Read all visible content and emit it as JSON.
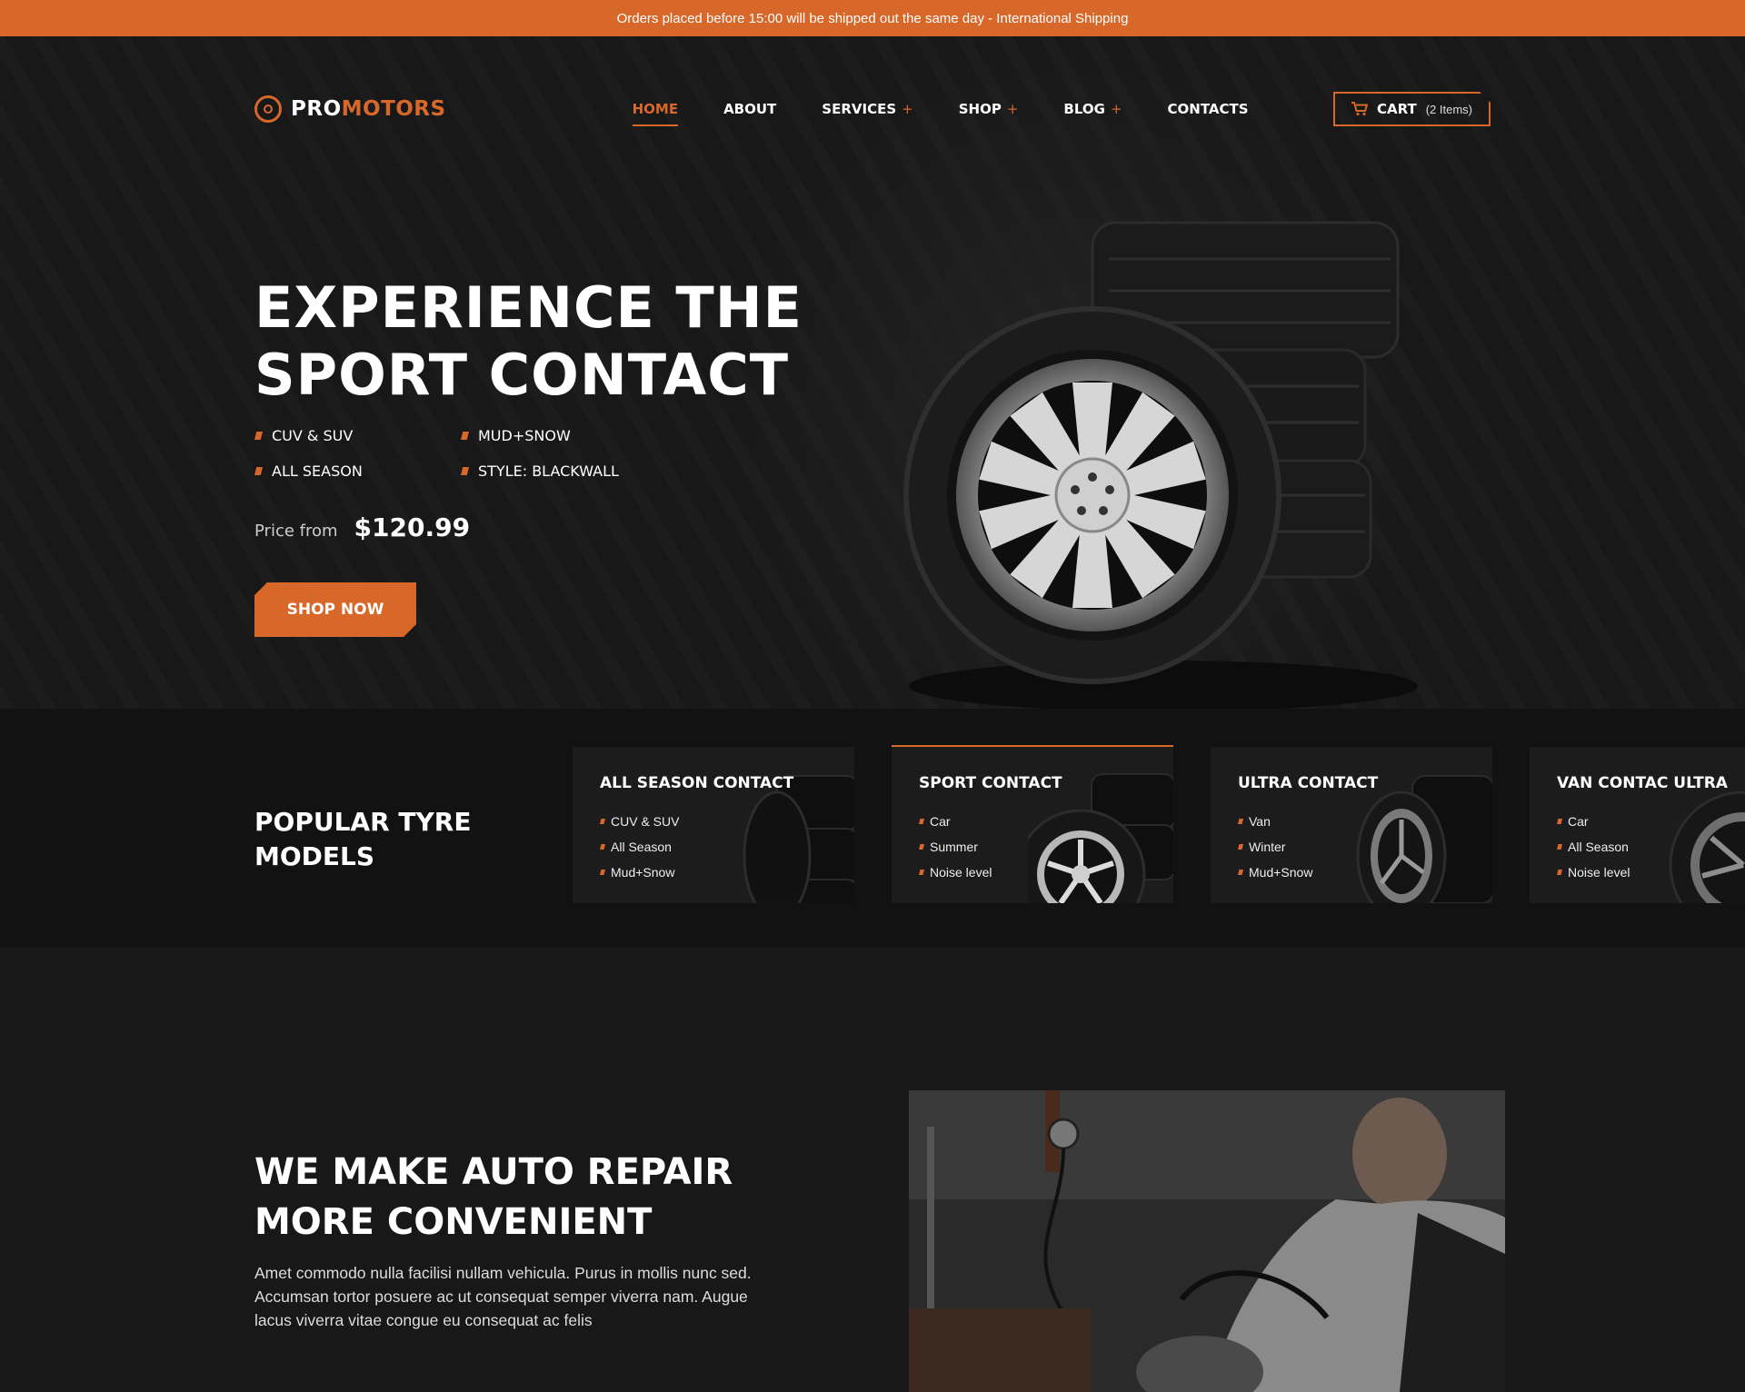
{
  "announcement": "Orders placed before 15:00 will be shipped out the same day - International Shipping",
  "logo": {
    "part1": "PRO",
    "part2": "MOTORS",
    "icon": "tyre-icon"
  },
  "nav": {
    "home": "HOME",
    "about": "ABOUT",
    "services": "SERVICES",
    "shop": "SHOP",
    "blog": "BLOG",
    "contacts": "CONTACTS",
    "plus": "+"
  },
  "cart": {
    "label": "CART",
    "count": "(2 Items)",
    "icon": "cart-icon"
  },
  "hero": {
    "title_line1": "EXPERIENCE THE",
    "title_line2": "SPORT CONTACT",
    "features": [
      "CUV & SUV",
      "MUD+SNOW",
      "ALL SEASON",
      "STYLE: BLACKWALL"
    ],
    "price_label": "Price from",
    "price_value": "$120.99",
    "cta": "SHOP NOW"
  },
  "models": {
    "title_line1": "POPULAR TYRE",
    "title_line2": "MODELS",
    "cards": [
      {
        "name": "ALL SEASON CONTACT",
        "items": [
          "CUV & SUV",
          "All Season",
          "Mud+Snow"
        ]
      },
      {
        "name": "SPORT CONTACT",
        "items": [
          "Car",
          "Summer",
          "Noise level"
        ]
      },
      {
        "name": "ULTRA CONTACT",
        "items": [
          "Van",
          "Winter",
          "Mud+Snow"
        ]
      },
      {
        "name": "VAN CONTAC ULTRA",
        "items": [
          "Car",
          "All Season",
          "Noise level"
        ]
      }
    ]
  },
  "repair": {
    "title_line1": "WE MAKE AUTO REPAIR",
    "title_line2": "MORE CONVENIENT",
    "text": "Amet commodo nulla facilisi nullam vehicula. Purus in mollis nunc sed. Accumsan tortor posuere ac ut consequat semper viverra nam. Augue lacus viverra vitae congue eu consequat ac felis"
  },
  "colors": {
    "accent": "#d8672a",
    "background": "#141414",
    "text": "#ffffff"
  }
}
